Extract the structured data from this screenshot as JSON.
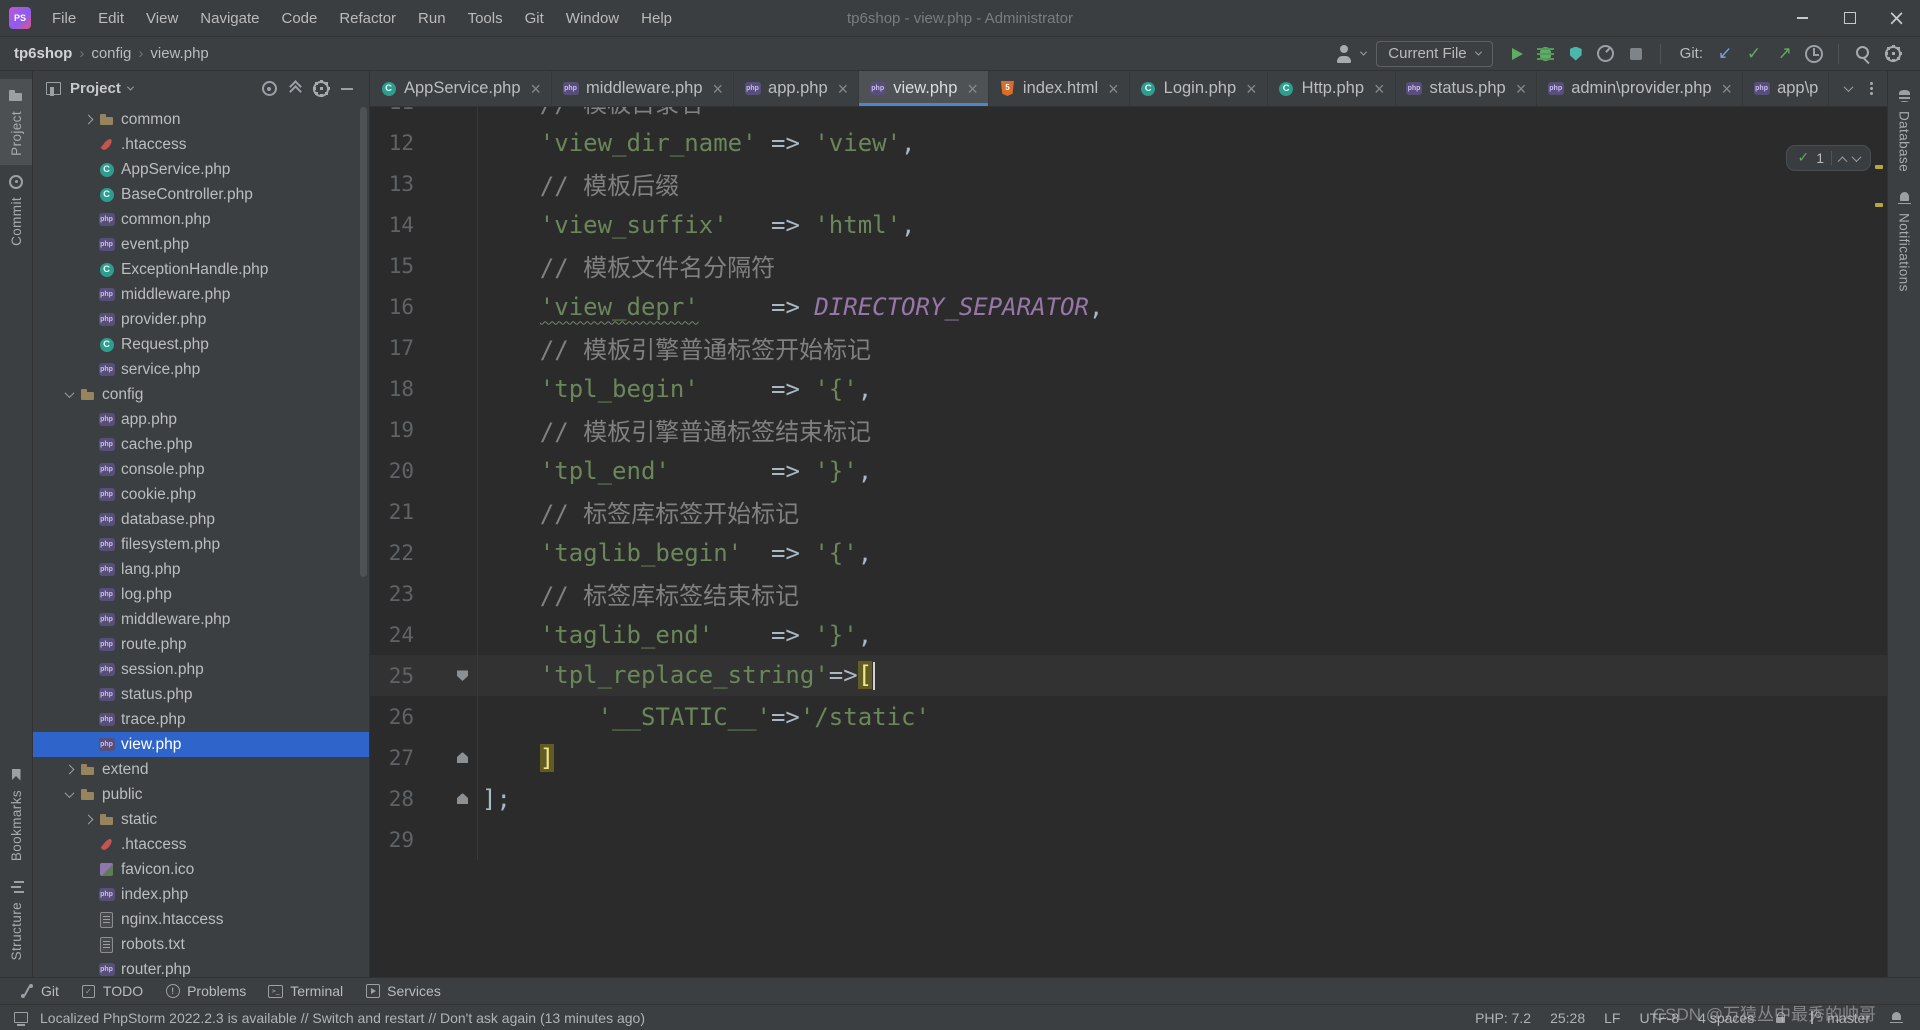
{
  "window": {
    "title": "tp6shop - view.php - Administrator",
    "logo": "PS",
    "menu": [
      "File",
      "Edit",
      "View",
      "Navigate",
      "Code",
      "Refactor",
      "Run",
      "Tools",
      "Git",
      "Window",
      "Help"
    ]
  },
  "toolbar": {
    "breadcrumbs": [
      "tp6shop",
      "config",
      "view.php"
    ],
    "run_config": "Current File",
    "run_icons": [
      "run",
      "debug",
      "coverage",
      "profiler",
      "stop"
    ],
    "git_label": "Git:",
    "git_icons": [
      "update",
      "commit-check",
      "push",
      "history"
    ],
    "misc_icons": [
      "search",
      "settings"
    ]
  },
  "left_stripe": {
    "top": [
      {
        "icon": "project-folder",
        "label": "Project",
        "active": true
      },
      {
        "icon": "commit",
        "label": "Commit",
        "active": false
      }
    ],
    "bottom": [
      {
        "icon": "bookmarks",
        "label": "Bookmarks",
        "active": false
      },
      {
        "icon": "structure",
        "label": "Structure",
        "active": false
      }
    ]
  },
  "right_stripe": {
    "top": [
      {
        "icon": "database",
        "label": "Database",
        "active": false
      },
      {
        "icon": "notifications",
        "label": "Notifications",
        "active": false
      }
    ],
    "bottom": []
  },
  "project_panel": {
    "title": "Project",
    "header_icons": [
      "locate",
      "collapse-all",
      "settings",
      "hide"
    ],
    "tree": [
      {
        "label": "common",
        "icon": "folder",
        "type": "folder",
        "state": "collapsed",
        "indent": 2
      },
      {
        "label": ".htaccess",
        "icon": "htaccess",
        "indent": 2
      },
      {
        "label": "AppService.php",
        "icon": "class",
        "indent": 2
      },
      {
        "label": "BaseController.php",
        "icon": "class",
        "indent": 2
      },
      {
        "label": "common.php",
        "icon": "php",
        "indent": 2
      },
      {
        "label": "event.php",
        "icon": "php",
        "indent": 2
      },
      {
        "label": "ExceptionHandle.php",
        "icon": "class",
        "indent": 2
      },
      {
        "label": "middleware.php",
        "icon": "php",
        "indent": 2
      },
      {
        "label": "provider.php",
        "icon": "php",
        "indent": 2
      },
      {
        "label": "Request.php",
        "icon": "class",
        "indent": 2
      },
      {
        "label": "service.php",
        "icon": "php",
        "indent": 2
      },
      {
        "label": "config",
        "icon": "folder",
        "type": "folder",
        "state": "expanded",
        "indent": 1
      },
      {
        "label": "app.php",
        "icon": "php",
        "indent": 2
      },
      {
        "label": "cache.php",
        "icon": "php",
        "indent": 2
      },
      {
        "label": "console.php",
        "icon": "php",
        "indent": 2
      },
      {
        "label": "cookie.php",
        "icon": "php",
        "indent": 2
      },
      {
        "label": "database.php",
        "icon": "php",
        "indent": 2
      },
      {
        "label": "filesystem.php",
        "icon": "php",
        "indent": 2
      },
      {
        "label": "lang.php",
        "icon": "php",
        "indent": 2
      },
      {
        "label": "log.php",
        "icon": "php",
        "indent": 2
      },
      {
        "label": "middleware.php",
        "icon": "php",
        "indent": 2
      },
      {
        "label": "route.php",
        "icon": "php",
        "indent": 2
      },
      {
        "label": "session.php",
        "icon": "php",
        "indent": 2
      },
      {
        "label": "status.php",
        "icon": "php",
        "indent": 2
      },
      {
        "label": "trace.php",
        "icon": "php",
        "indent": 2
      },
      {
        "label": "view.php",
        "icon": "php",
        "indent": 2,
        "selected": true
      },
      {
        "label": "extend",
        "icon": "folder",
        "type": "folder",
        "state": "collapsed",
        "indent": 1
      },
      {
        "label": "public",
        "icon": "folder",
        "type": "folder",
        "state": "expanded",
        "indent": 1
      },
      {
        "label": "static",
        "icon": "folder",
        "type": "folder",
        "state": "collapsed",
        "indent": 2
      },
      {
        "label": ".htaccess",
        "icon": "htaccess",
        "indent": 2
      },
      {
        "label": "favicon.ico",
        "icon": "image",
        "indent": 2
      },
      {
        "label": "index.php",
        "icon": "php",
        "indent": 2
      },
      {
        "label": "nginx.htaccess",
        "icon": "text",
        "indent": 2
      },
      {
        "label": "robots.txt",
        "icon": "text",
        "indent": 2
      },
      {
        "label": "router.php",
        "icon": "php",
        "indent": 2
      }
    ]
  },
  "tabs": [
    {
      "label": "AppService.php",
      "icon": "class"
    },
    {
      "label": "middleware.php",
      "icon": "php"
    },
    {
      "label": "app.php",
      "icon": "php"
    },
    {
      "label": "view.php",
      "icon": "php",
      "active": true
    },
    {
      "label": "index.html",
      "icon": "html"
    },
    {
      "label": "Login.php",
      "icon": "class"
    },
    {
      "label": "Http.php",
      "icon": "class"
    },
    {
      "label": "status.php",
      "icon": "php"
    },
    {
      "label": "admin\\provider.php",
      "icon": "php"
    },
    {
      "label": "app\\p",
      "icon": "php",
      "truncated": true
    }
  ],
  "editor": {
    "inspection": {
      "ok_count": "1"
    },
    "lines": [
      {
        "n": "11",
        "tk": [
          [
            "c",
            "    // 模板目录名"
          ]
        ]
      },
      {
        "n": "12",
        "tk": [
          [
            "d",
            "    "
          ],
          [
            "s",
            "'view_dir_name'"
          ],
          [
            "d",
            " => "
          ],
          [
            "s",
            "'view'"
          ],
          [
            "d",
            ","
          ]
        ]
      },
      {
        "n": "13",
        "tk": [
          [
            "c",
            "    // 模板后缀"
          ]
        ]
      },
      {
        "n": "14",
        "tk": [
          [
            "d",
            "    "
          ],
          [
            "s",
            "'view_suffix'"
          ],
          [
            "d",
            "   => "
          ],
          [
            "s",
            "'html'"
          ],
          [
            "d",
            ","
          ]
        ]
      },
      {
        "n": "15",
        "tk": [
          [
            "c",
            "    // 模板文件名分隔符"
          ]
        ]
      },
      {
        "n": "16",
        "tk": [
          [
            "d",
            "    "
          ],
          [
            "st",
            "'view_depr'"
          ],
          [
            "d",
            "     => "
          ],
          [
            "k",
            "DIRECTORY_SEPARATOR"
          ],
          [
            "d",
            ","
          ]
        ]
      },
      {
        "n": "17",
        "tk": [
          [
            "c",
            "    // 模板引擎普通标签开始标记"
          ]
        ]
      },
      {
        "n": "18",
        "tk": [
          [
            "d",
            "    "
          ],
          [
            "s",
            "'tpl_begin'"
          ],
          [
            "d",
            "     => "
          ],
          [
            "s",
            "'{'"
          ],
          [
            "d",
            ","
          ]
        ]
      },
      {
        "n": "19",
        "tk": [
          [
            "c",
            "    // 模板引擎普通标签结束标记"
          ]
        ]
      },
      {
        "n": "20",
        "tk": [
          [
            "d",
            "    "
          ],
          [
            "s",
            "'tpl_end'"
          ],
          [
            "d",
            "       => "
          ],
          [
            "s",
            "'}'"
          ],
          [
            "d",
            ","
          ]
        ]
      },
      {
        "n": "21",
        "tk": [
          [
            "c",
            "    // 标签库标签开始标记"
          ]
        ]
      },
      {
        "n": "22",
        "tk": [
          [
            "d",
            "    "
          ],
          [
            "s",
            "'taglib_begin'"
          ],
          [
            "d",
            "  => "
          ],
          [
            "s",
            "'{'"
          ],
          [
            "d",
            ","
          ]
        ]
      },
      {
        "n": "23",
        "tk": [
          [
            "c",
            "    // 标签库标签结束标记"
          ]
        ]
      },
      {
        "n": "24",
        "tk": [
          [
            "d",
            "    "
          ],
          [
            "s",
            "'taglib_end'"
          ],
          [
            "d",
            "    => "
          ],
          [
            "s",
            "'}'"
          ],
          [
            "d",
            ","
          ]
        ]
      },
      {
        "n": "25",
        "cur": true,
        "fold": "open",
        "tk": [
          [
            "d",
            "    "
          ],
          [
            "s",
            "'tpl_replace_string'"
          ],
          [
            "d",
            "=>"
          ],
          [
            "m",
            "["
          ],
          [
            "caret",
            ""
          ]
        ]
      },
      {
        "n": "26",
        "tk": [
          [
            "d",
            "        "
          ],
          [
            "s",
            "'__STATIC__'"
          ],
          [
            "d",
            "=>"
          ],
          [
            "s",
            "'/static'"
          ]
        ]
      },
      {
        "n": "27",
        "fold": "close",
        "tk": [
          [
            "d",
            "    "
          ],
          [
            "m",
            "]"
          ]
        ]
      },
      {
        "n": "28",
        "fold": "close",
        "tk": [
          [
            "d",
            "];"
          ]
        ]
      },
      {
        "n": "29",
        "tk": []
      }
    ]
  },
  "bottom_bar": {
    "items": [
      {
        "icon": "git-branch",
        "label": "Git"
      },
      {
        "icon": "todo",
        "label": "TODO"
      },
      {
        "icon": "problems",
        "label": "Problems"
      },
      {
        "icon": "terminal",
        "label": "Terminal"
      },
      {
        "icon": "services",
        "label": "Services"
      }
    ]
  },
  "status_bar": {
    "message": "Localized PhpStorm 2022.2.3 is available // Switch and restart // Don't ask again (13 minutes ago)",
    "right": [
      {
        "label": "PHP: 7.2"
      },
      {
        "label": "25:28"
      },
      {
        "label": "LF"
      },
      {
        "label": "UTF-8"
      },
      {
        "label": "4 spaces"
      },
      {
        "icon": "lock",
        "label": ""
      },
      {
        "icon": "branch",
        "label": "master"
      },
      {
        "icon": "bell",
        "label": ""
      }
    ]
  },
  "watermark": "CSDN @万猿丛中最秀的帅哥",
  "colors": {
    "accent": "#4a88c7",
    "selection": "#2f65ca",
    "run_green": "#5fad65",
    "editor_bg": "#2b2b2b",
    "panel_bg": "#3c3f41",
    "string": "#6a8759",
    "comment": "#808080",
    "constant": "#9876aa"
  }
}
